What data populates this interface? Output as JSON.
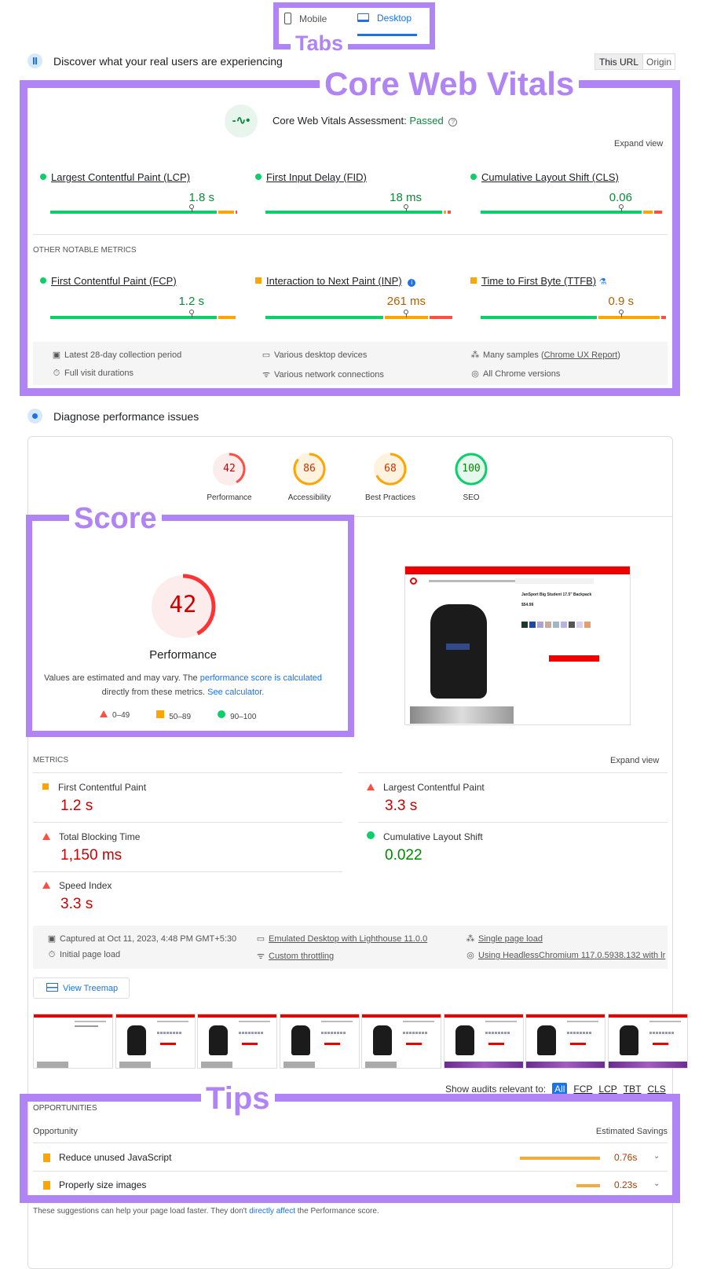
{
  "annotations": {
    "tabs": "Tabs",
    "core_web_vitals": "Core Web Vitals",
    "score": "Score",
    "tips": "Tips"
  },
  "tabs": [
    {
      "label": "Mobile",
      "icon": "phone-icon",
      "active": false
    },
    {
      "label": "Desktop",
      "icon": "laptop-icon",
      "active": true
    }
  ],
  "field": {
    "title": "Discover what your real users are experiencing",
    "toggle": [
      "This URL",
      "Origin"
    ],
    "assessment_label": "Core Web Vitals Assessment:",
    "assessment_status": "Passed",
    "expand": "Expand view",
    "core": [
      {
        "name": "Largest Contentful Paint (LCP)",
        "value": "1.8 s",
        "status": "good"
      },
      {
        "name": "First Input Delay (FID)",
        "value": "18 ms",
        "status": "good"
      },
      {
        "name": "Cumulative Layout Shift (CLS)",
        "value": "0.06",
        "status": "good"
      }
    ],
    "other_heading": "OTHER NOTABLE METRICS",
    "other": [
      {
        "name": "First Contentful Paint (FCP)",
        "value": "1.2 s",
        "status": "good"
      },
      {
        "name": "Interaction to Next Paint (INP)",
        "value": "261 ms",
        "status": "needs-improvement"
      },
      {
        "name": "Time to First Byte (TTFB)",
        "value": "0.9 s",
        "status": "needs-improvement"
      }
    ],
    "info": [
      "Latest 28-day collection period",
      "Various desktop devices",
      "Many samples (",
      "Chrome UX Report",
      ")",
      "Full visit durations",
      "Various network connections",
      "All Chrome versions"
    ]
  },
  "lab": {
    "title": "Diagnose performance issues",
    "categories": [
      {
        "label": "Performance",
        "score": "42"
      },
      {
        "label": "Accessibility",
        "score": "86"
      },
      {
        "label": "Best Practices",
        "score": "68"
      },
      {
        "label": "SEO",
        "score": "100"
      }
    ],
    "main_score": "42",
    "main_label": "Performance",
    "note_1": "Values are estimated and may vary. The ",
    "note_link_1": "performance score is calculated",
    "note_2": "directly from these metrics. ",
    "note_link_2": "See calculator.",
    "legend": [
      "0–49",
      "50–89",
      "90–100"
    ],
    "metrics_heading": "METRICS",
    "expand": "Expand view",
    "metrics": [
      {
        "name": "First Contentful Paint",
        "value": "1.2 s",
        "status": "average"
      },
      {
        "name": "Largest Contentful Paint",
        "value": "3.3 s",
        "status": "fail"
      },
      {
        "name": "Total Blocking Time",
        "value": "1,150 ms",
        "status": "fail"
      },
      {
        "name": "Cumulative Layout Shift",
        "value": "0.022",
        "status": "pass"
      },
      {
        "name": "Speed Index",
        "value": "3.3 s",
        "status": "fail"
      }
    ],
    "info": [
      "Captured at Oct 11, 2023, 4:48 PM GMT+5:30",
      "Emulated Desktop with Lighthouse 11.0.0",
      "Single page load",
      "Initial page load",
      "Custom throttling",
      "Using HeadlessChromium 117.0.5938.132 with lr"
    ],
    "treemap": "View Treemap",
    "screenshot_product": "JanSport Big Student 17.5\" Backpack",
    "screenshot_price": "$54.99",
    "filter_label": "Show audits relevant to:",
    "filters": [
      "All",
      "FCP",
      "LCP",
      "TBT",
      "CLS"
    ],
    "opportunities_heading": "OPPORTUNITIES",
    "col_opportunity": "Opportunity",
    "col_savings": "Estimated Savings",
    "opportunities": [
      {
        "name": "Reduce unused JavaScript",
        "savings": "0.76s"
      },
      {
        "name": "Properly size images",
        "savings": "0.23s"
      }
    ],
    "footnote_1": "These suggestions can help your page load faster. They don't ",
    "footnote_link": "directly affect",
    "footnote_2": " the Performance score."
  },
  "colors": {
    "good": "#0cce6b",
    "average": "#ffa400",
    "poor": "#ff4e42",
    "annotation": "#b084f5",
    "link": "#1a73e8"
  }
}
